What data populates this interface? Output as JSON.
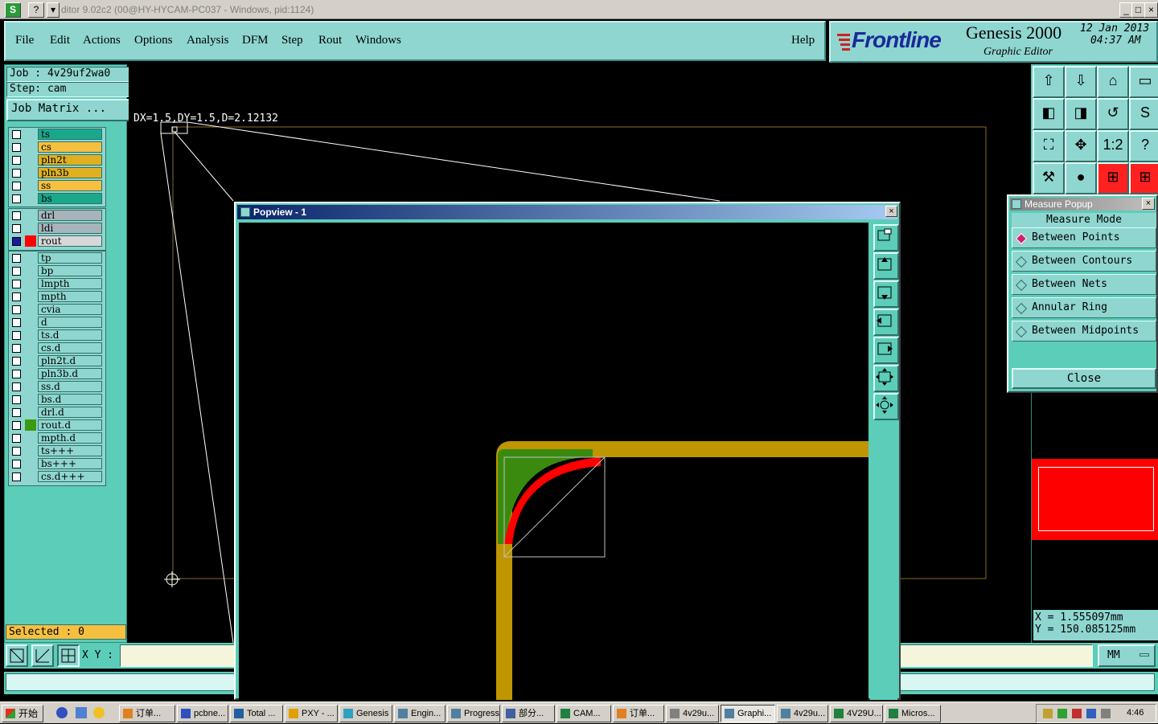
{
  "window": {
    "title": "ditor 9.02c2 (00@HY-HYCAM-PC037 - Windows, pid:1124)",
    "s_icon": "S",
    "help_icon": "?",
    "controls": [
      "_",
      "□",
      "×"
    ]
  },
  "menu": [
    "File",
    "Edit",
    "Actions",
    "Options",
    "Analysis",
    "DFM",
    "Step",
    "Rout",
    "Windows"
  ],
  "help_label": "Help",
  "brand": {
    "logo": "Frontline",
    "product": "Genesis 2000",
    "subtitle": "Graphic Editor",
    "date": "12 Jan 2013",
    "time": "04:37 AM"
  },
  "job": {
    "job_line": "Job : 4v29uf2wa0",
    "step_line": "Step: cam",
    "matrix_button": "Job Matrix ..."
  },
  "layers": {
    "group1": [
      {
        "name": "ts",
        "color": "#1aa88c"
      },
      {
        "name": "cs",
        "color": "#f5c040"
      },
      {
        "name": "pln2t",
        "color": "#e0b020"
      },
      {
        "name": "pln3b",
        "color": "#e0b020"
      },
      {
        "name": "ss",
        "color": "#f5c040"
      },
      {
        "name": "bs",
        "color": "#1aa88c"
      }
    ],
    "group2": [
      {
        "name": "drl",
        "color": "#a8b4bc"
      },
      {
        "name": "ldi",
        "color": "#a8b4bc"
      },
      {
        "name": "rout",
        "color": "#d8d8d8"
      }
    ],
    "group3": [
      "tp",
      "bp",
      "lmpth",
      "mpth",
      "cvia",
      "d",
      "ts.d",
      "cs.d",
      "pln2t.d",
      "pln3b.d",
      "ss.d",
      "bs.d",
      "drl.d",
      "rout.d",
      "mpth.d",
      "ts+++",
      "bs+++",
      "cs.d+++"
    ]
  },
  "selected_label": "Selected : 0",
  "measure_readout": "DX=1.5,DY=1.5,D=2.12132",
  "xy_label": "X Y :",
  "unit": "MM",
  "coords": {
    "x": "X = 1.555097mm",
    "y": "Y = 150.085125mm"
  },
  "popview": {
    "title": "Popview - 1"
  },
  "measure_popup": {
    "title": "Measure Popup",
    "header": "Measure Mode",
    "options": [
      "Between Points",
      "Between Contours",
      "Between Nets",
      "Annular Ring",
      "Between Midpoints"
    ],
    "selected": "Between Points",
    "close": "Close"
  },
  "toolbar_icons": [
    "zoom-home-icon",
    "zoom-save-icon",
    "home-icon",
    "window-icon",
    "pan-left-icon",
    "pan-right-icon",
    "rotate-icon",
    "snap-icon",
    "fit-icon",
    "center-icon",
    "scale-1to2-icon",
    "help-icon",
    "tools-icon",
    "probe-icon",
    "net-icon",
    "net-alt-icon"
  ],
  "toolbar_labels": {
    "scale": "1:2",
    "help": "?"
  },
  "taskbar": {
    "start": "开始",
    "tasks": [
      "订单...",
      "pcbne...",
      "Total ...",
      "PXY - ...",
      "Genesis",
      "Engin...",
      "Progress",
      "部分...",
      "CAM...",
      "订单...",
      "4v29u...",
      "Graphi...",
      "4v29u...",
      "4V29U...",
      "Micros..."
    ],
    "active": "Graphi...",
    "clock": "4:46"
  },
  "colors": {
    "panel": "#5ccdb8",
    "panel_light": "#8fd6d0",
    "trace_gold": "#bf9600",
    "trace_green": "#3a8a10",
    "trace_red": "#ff0000"
  }
}
